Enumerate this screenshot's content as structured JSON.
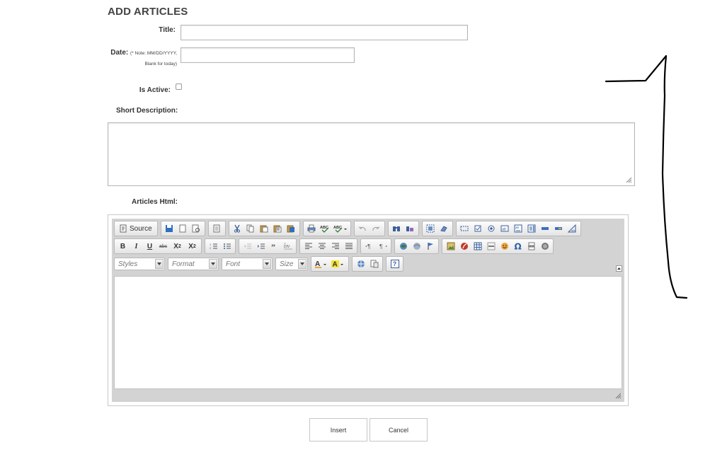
{
  "form": {
    "heading": "ADD ARTICLES",
    "title_label": "Title:",
    "title_value": "",
    "date_label": "Date:",
    "date_note_line1": "(* Note: MM/DD/YYYY,",
    "date_note_line2": "Blank for today)",
    "date_value": "",
    "is_active_label": "Is Active:",
    "is_active_checked": false,
    "short_description_label": "Short Description:",
    "short_description_value": "",
    "articles_html_label": "Articles Html:"
  },
  "editor": {
    "source_label": "Source",
    "toolbar_row1": [
      "save-icon",
      "new-page-icon",
      "preview-icon",
      "templates-icon",
      "cut-icon",
      "copy-icon",
      "paste-icon",
      "paste-text-icon",
      "paste-word-icon",
      "print-icon",
      "spellcheck-icon",
      "scayt-icon",
      "undo-icon",
      "redo-icon",
      "find-icon",
      "replace-icon",
      "select-all-icon",
      "remove-format-icon",
      "form-icon",
      "checkbox-icon",
      "radio-icon",
      "textfield-icon",
      "textarea-icon",
      "select-icon",
      "button-icon",
      "image-button-icon",
      "hidden-field-icon"
    ],
    "toolbar_row2": [
      "bold",
      "italic",
      "underline",
      "strike",
      "subscript",
      "superscript",
      "numbered-list-icon",
      "bulleted-list-icon",
      "outdent-icon",
      "indent-icon",
      "blockquote-icon",
      "div-icon",
      "align-left-icon",
      "align-center-icon",
      "align-right-icon",
      "justify-icon",
      "ltr-icon",
      "rtl-icon",
      "link-icon",
      "unlink-icon",
      "anchor-icon",
      "image-icon",
      "flash-icon",
      "table-icon",
      "horizontal-rule-icon",
      "smiley-icon",
      "special-char-icon",
      "page-break-icon",
      "iframe-icon"
    ],
    "format_buttons": {
      "bold": "B",
      "italic": "I",
      "underline": "U",
      "strike": "abc",
      "subscript": "X",
      "sub_mark": "2",
      "superscript": "X",
      "sup_mark": "2"
    },
    "combos": {
      "styles": "Styles",
      "format": "Format",
      "font": "Font",
      "size": "Size"
    },
    "toolbar_row3": [
      "text-color-icon",
      "background-color-icon",
      "maximize-icon",
      "show-blocks-icon",
      "about-icon"
    ],
    "about_label": "?"
  },
  "actions": {
    "insert_label": "Insert",
    "cancel_label": "Cancel"
  },
  "colors": {
    "accent_link": "#3b6fb6",
    "toolbar_bg": "#d3d3d3",
    "border": "#b5b5b5",
    "annotation": "#000000"
  }
}
